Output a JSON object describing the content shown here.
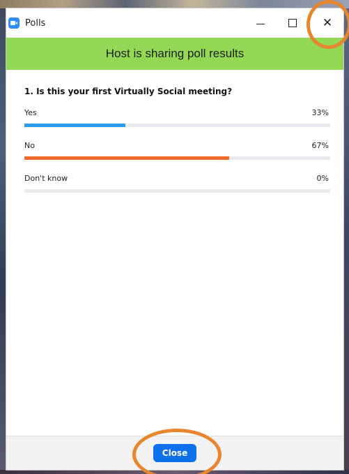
{
  "window": {
    "title": "Polls",
    "app_icon": "zoom-camera-icon",
    "controls": {
      "minimize_icon": "minimize-icon",
      "maximize_icon": "maximize-icon",
      "close_glyph": "✕"
    }
  },
  "banner": {
    "text": "Host is sharing poll results",
    "color": "#93d854"
  },
  "poll": {
    "question": "1. Is this your first Virtually Social meeting?",
    "options": [
      {
        "label": "Yes",
        "percent_text": "33%",
        "value": 33,
        "color": "#2d9cf0"
      },
      {
        "label": "No",
        "percent_text": "67%",
        "value": 67,
        "color": "#f26b2a"
      },
      {
        "label": "Don't know",
        "percent_text": "0%",
        "value": 0,
        "color": "#2d9cf0"
      }
    ]
  },
  "footer": {
    "close_label": "Close",
    "close_color": "#0e71eb"
  },
  "annotations": {
    "ring_color": "#e8852f"
  }
}
